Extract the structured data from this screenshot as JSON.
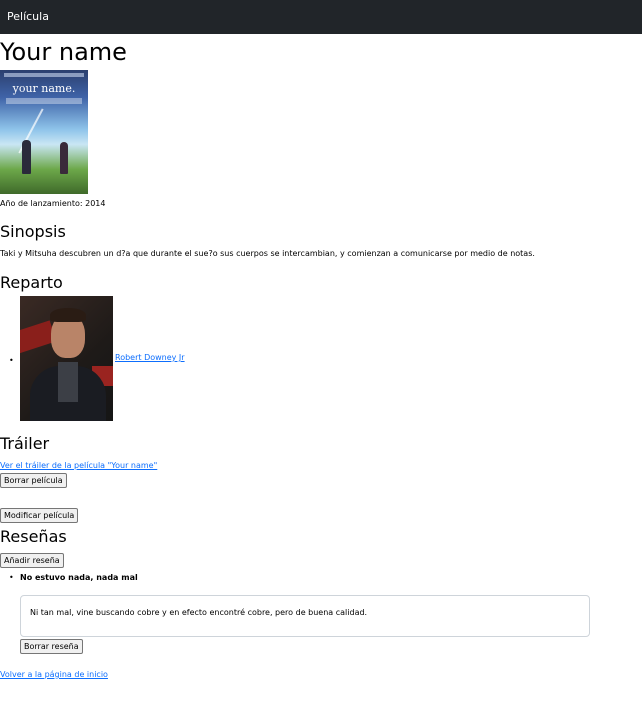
{
  "navbar": {
    "brand": "Película"
  },
  "movie": {
    "title": "Your name",
    "poster": {
      "name_text": "your name."
    },
    "release_label": "Año de lanzamiento: 2014"
  },
  "synopsis": {
    "heading": "Sinopsis",
    "text": "Taki y Mitsuha descubren un d?a que durante el sue?o sus cuerpos se intercambian, y comienzan a comunicarse por medio de notas."
  },
  "cast": {
    "heading": "Reparto",
    "members": [
      {
        "name": "Robert Downey Jr"
      }
    ]
  },
  "trailer": {
    "heading": "Tráiler",
    "link_text": "Ver el tráiler de la película \"Your name\""
  },
  "actions": {
    "delete_movie": "Borrar película",
    "edit_movie": "Modificar película"
  },
  "reviews": {
    "heading": "Reseñas",
    "add_button": "Añadir reseña",
    "items": [
      {
        "title": "No estuvo nada, nada mal",
        "body": "Ni tan mal, vine buscando cobre y en efecto encontré cobre, pero de buena calidad.",
        "delete_button": "Borrar reseña"
      }
    ]
  },
  "footer": {
    "home_link": "Volver a la página de inicio"
  },
  "colors": {
    "navbar_bg": "#212529",
    "link": "#0d6efd"
  }
}
